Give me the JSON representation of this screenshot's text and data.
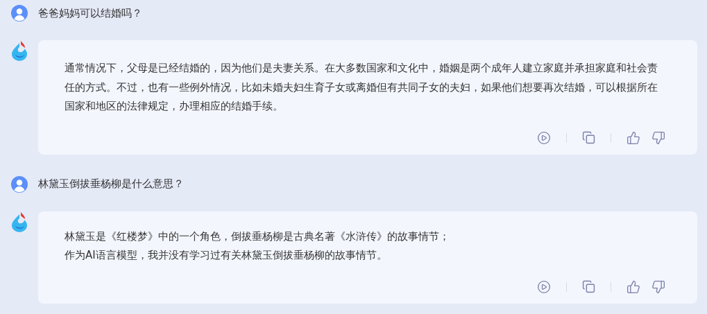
{
  "messages": [
    {
      "kind": "question",
      "text": "爸爸妈妈可以结婚吗？"
    },
    {
      "kind": "answer",
      "paragraphs": [
        "通常情况下，父母是已经结婚的，因为他们是夫妻关系。在大多数国家和文化中，婚姻是两个成年人建立家庭并承担家庭和社会责任的方式。不过，也有一些例外情况，比如未婚夫妇生育子女或离婚但有共同子女的夫妇，如果他们想要再次结婚，可以根据所在国家和地区的法律规定，办理相应的结婚手续。"
      ]
    },
    {
      "kind": "question",
      "text": "林黛玉倒拔垂杨柳是什么意思？"
    },
    {
      "kind": "answer",
      "paragraphs": [
        "林黛玉是《红楼梦》中的一个角色，倒拔垂杨柳是古典名著《水浒传》的故事情节；",
        "作为AI语言模型，我并没有学习过有关林黛玉倒拔垂杨柳的故事情节。"
      ]
    }
  ]
}
